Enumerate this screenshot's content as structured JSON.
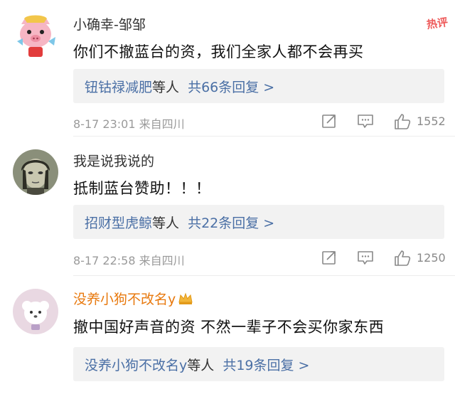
{
  "comments": [
    {
      "username": "小确幸-邹邹",
      "hot_badge": "热评",
      "content": "你们不撤蓝台的资，我们全家人都不会再买",
      "reply": {
        "names": "钮钴禄减肥",
        "suffix": "等人",
        "count_text": "共66条回复 >"
      },
      "time": "8-17 23:01  来自四川",
      "likes": "1552"
    },
    {
      "username": "我是说我说的",
      "content": "抵制蓝台赞助！！！",
      "reply": {
        "names": "招财型虎鲸",
        "suffix": "等人",
        "count_text": "共22条回复 >"
      },
      "time": "8-17 22:58  来自四川",
      "likes": "1250"
    },
    {
      "username": "没养小狗不改名y",
      "content": "撤中国好声音的资 不然一辈子不会买你家东西",
      "reply": {
        "names": "没养小狗不改名y",
        "suffix": "等人",
        "count_text": "共19条回复 >"
      }
    }
  ],
  "icons": [
    "share-icon",
    "comment-icon",
    "like-icon",
    "crown-icon"
  ],
  "colors": {
    "link": "#4a6fa5",
    "vip_name": "#e8790e",
    "hot": "#ee5a5a",
    "meta": "#9a9a9a"
  }
}
